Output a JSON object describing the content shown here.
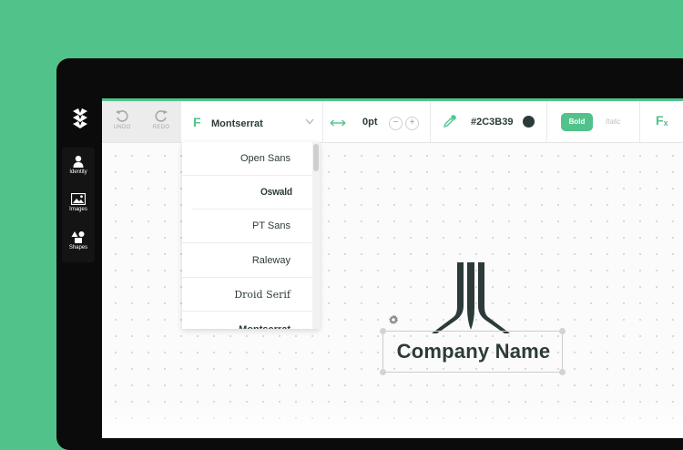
{
  "sidebar": {
    "items": [
      {
        "label": "Identity",
        "icon": "person-icon"
      },
      {
        "label": "Images",
        "icon": "image-icon"
      },
      {
        "label": "Shapes",
        "icon": "shapes-icon"
      }
    ]
  },
  "toolbar": {
    "undo_label": "UNDO",
    "redo_label": "REDO",
    "font_icon": "F",
    "font_value": "Montserrat",
    "letter_spacing": "0pt",
    "decrease_symbol": "−",
    "increase_symbol": "+",
    "color_hex": "#2C3B39",
    "swatch_color": "#2C3B39",
    "bold_label": "Bold",
    "italic_label": "Italic",
    "effects_label": "F",
    "effects_sub": "x"
  },
  "font_dropdown": {
    "options": [
      "Open Sans",
      "Oswald",
      "PT Sans",
      "Raleway",
      "Droid Serif",
      "Montserrat"
    ]
  },
  "canvas": {
    "company_name": "Company Name"
  },
  "colors": {
    "accent": "#52C28B",
    "text_dark": "#2C3B39",
    "bezel": "#0B0B0B"
  }
}
